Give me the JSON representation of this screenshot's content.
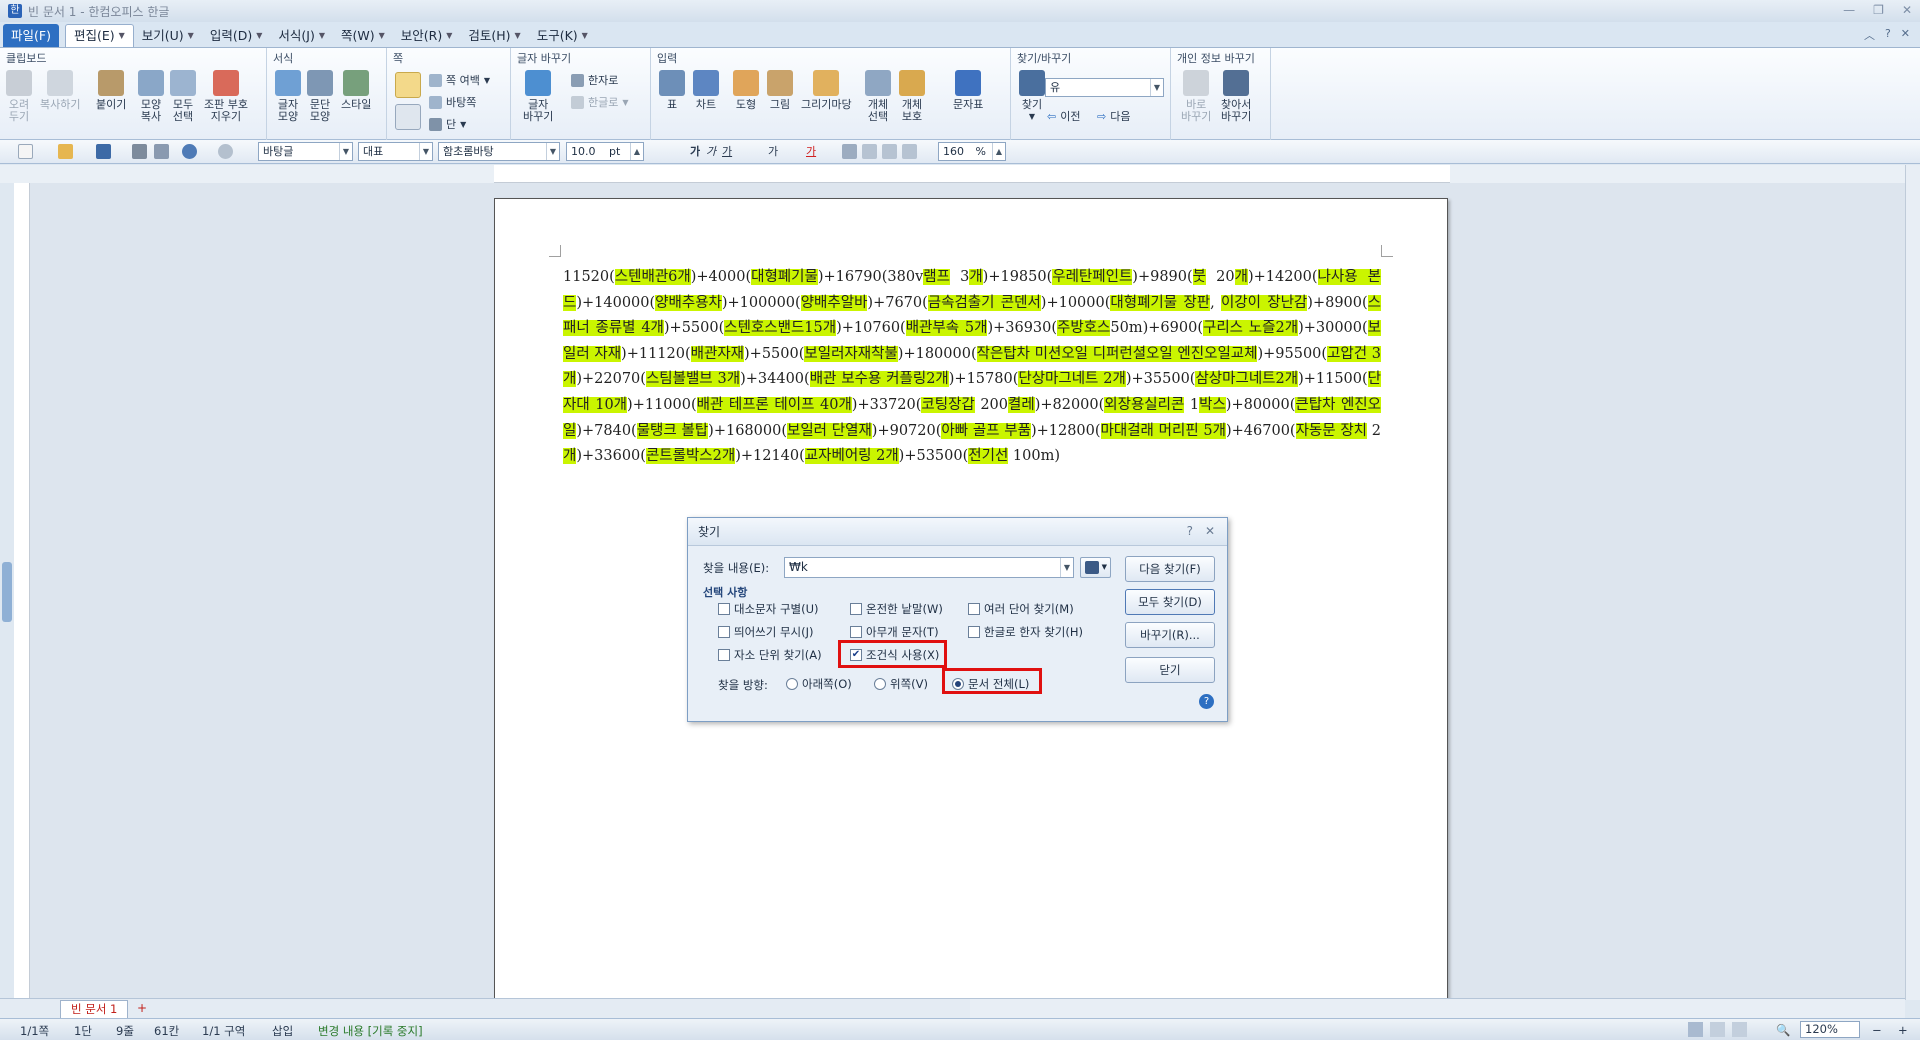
{
  "window": {
    "title": "빈 문서 1 - 한컴오피스 한글",
    "min": "—",
    "restore": "❐",
    "close": "✕"
  },
  "menu": {
    "items": [
      "파일(F)",
      "편집(E)",
      "보기(U)",
      "입력(D)",
      "서식(J)",
      "쪽(W)",
      "보안(R)",
      "검토(H)",
      "도구(K)"
    ],
    "right": [
      "︿",
      "?",
      "✕"
    ]
  },
  "ribbon": {
    "groups": {
      "clipboard": "클립보드",
      "format": "서식",
      "page": "쪽",
      "charchange": "글자 바꾸기",
      "input": "입력",
      "findreplace": "찾기/바꾸기",
      "privacy": "개인 정보 바꾸기"
    },
    "clipboard": {
      "cut": "오려\n두기",
      "copy": "복사하기",
      "paste": "붙이기",
      "shape_copy": "모양\n복사",
      "select_all": "모두\n선택",
      "remove_code": "조판 부호\n지우기"
    },
    "format": {
      "char_shape": "글자\n모양",
      "para_shape": "문단\n모양",
      "style": "스타일"
    },
    "page": {
      "margin": "쪽 여백",
      "background": "바탕쪽",
      "columns": "단"
    },
    "charchange": {
      "convert": "글자\n바꾸기",
      "hanja": "한자로",
      "hangul": "한글로"
    },
    "input": {
      "table": "표",
      "chart": "차트",
      "shape": "도형",
      "picture": "그림",
      "drawing": "그리기마당",
      "obj_select": "개체\n선택",
      "obj_protect": "개체\n보호",
      "symbols": "문자표"
    },
    "findreplace": {
      "find": "찾기",
      "combo_value": "유",
      "prev": "이전",
      "next": "다음"
    },
    "privacy": {
      "replace": "바로\n바꾸기",
      "find_replace": "찾아서\n바꾸기"
    }
  },
  "toolbar": {
    "style": "바탕글",
    "lang": "대표",
    "font": "함초롬바탕",
    "size": "10.0",
    "unit": "pt",
    "bold": "가",
    "italic": "가",
    "underline": "가",
    "strike": "가",
    "color": "가",
    "zoom": "160",
    "zoom_unit": "%"
  },
  "document": {
    "segments": [
      [
        "11520(",
        false
      ],
      [
        "스텐배관6개",
        true
      ],
      [
        ")+4000(",
        false
      ],
      [
        "대형폐기물",
        true
      ],
      [
        ")+16790(380v",
        false
      ],
      [
        "램프",
        true
      ],
      [
        " 3",
        false
      ],
      [
        "개",
        true
      ],
      [
        ")+19850(",
        false
      ],
      [
        "우레탄페인트",
        true
      ],
      [
        ")+9890(",
        false
      ],
      [
        "붓",
        true
      ],
      [
        " 20",
        false
      ],
      [
        "개",
        true
      ],
      [
        ")+14200(",
        false
      ],
      [
        "나사용 본드",
        true
      ],
      [
        ")+140000(",
        false
      ],
      [
        "양배추용차",
        true
      ],
      [
        ")+100000(",
        false
      ],
      [
        "양배추알바",
        true
      ],
      [
        ")+7670(",
        false
      ],
      [
        "금속검출기 콘덴서",
        true
      ],
      [
        ")+10000(",
        false
      ],
      [
        "대형폐기물 장판",
        true
      ],
      [
        ", ",
        false
      ],
      [
        "이강이 장난감",
        true
      ],
      [
        ")+8900(",
        false
      ],
      [
        "스패너 종류별 4개",
        true
      ],
      [
        ")+5500(",
        false
      ],
      [
        "스텐호스밴드15개",
        true
      ],
      [
        ")+10760(",
        false
      ],
      [
        "배관부속 5개",
        true
      ],
      [
        ")+36930(",
        false
      ],
      [
        "주방호스",
        true
      ],
      [
        "50m)+6900(",
        false
      ],
      [
        "구리스 노즐2개",
        true
      ],
      [
        ")+30000(",
        false
      ],
      [
        "보일러 자재",
        true
      ],
      [
        ")+11120(",
        false
      ],
      [
        "배관자재",
        true
      ],
      [
        ")+5500(",
        false
      ],
      [
        "보일러자재착불",
        true
      ],
      [
        ")+180000(",
        false
      ],
      [
        "작은탑차 미션오일 디퍼런셜오일 엔진오일교체",
        true
      ],
      [
        ")+95500(",
        false
      ],
      [
        "고압건 3개",
        true
      ],
      [
        ")+22070(",
        false
      ],
      [
        "스팀볼밸브 3개",
        true
      ],
      [
        ")+34400(",
        false
      ],
      [
        "배관 보수용  커플링2개",
        true
      ],
      [
        ")+15780(",
        false
      ],
      [
        "단상마그네트 2개",
        true
      ],
      [
        ")+35500(",
        false
      ],
      [
        "삼상마그네트2개",
        true
      ],
      [
        ")+11500(",
        false
      ],
      [
        "단자대 10개",
        true
      ],
      [
        ")+11000(",
        false
      ],
      [
        "배관 테프론 테이프 40개",
        true
      ],
      [
        ")+33720(",
        false
      ],
      [
        "코팅장갑",
        true
      ],
      [
        " 200",
        false
      ],
      [
        "켤레",
        true
      ],
      [
        ")+82000(",
        false
      ],
      [
        "외장용실리콘",
        true
      ],
      [
        " 1",
        false
      ],
      [
        "박스",
        true
      ],
      [
        ")+80000(",
        false
      ],
      [
        "큰탑차 엔진오일",
        true
      ],
      [
        ")+7840(",
        false
      ],
      [
        "물탱크 볼탑",
        true
      ],
      [
        ")+168000(",
        false
      ],
      [
        "보일러 단열재",
        true
      ],
      [
        ")+90720(",
        false
      ],
      [
        "아빠 골프 부품",
        true
      ],
      [
        ")+12800(",
        false
      ],
      [
        "마대걸래 머리핀 5개",
        true
      ],
      [
        ")+46700(",
        false
      ],
      [
        "자동문 장치",
        true
      ],
      [
        " 2",
        false
      ],
      [
        "개",
        true
      ],
      [
        ")+33600(",
        false
      ],
      [
        "콘트롤박스2개",
        true
      ],
      [
        ")+12140(",
        false
      ],
      [
        "교자베어링 2개",
        true
      ],
      [
        ")+53500(",
        false
      ],
      [
        "전기선",
        true
      ],
      [
        " 100m)",
        false
      ]
    ]
  },
  "dialog": {
    "title": "찾기",
    "help": "?",
    "close": "✕",
    "find_label": "찾을 내용(E):",
    "find_value": "₩k",
    "options_title": "선택 사항",
    "options": [
      {
        "label": "대소문자 구별(U)",
        "checked": false
      },
      {
        "label": "온전한 낱말(W)",
        "checked": false
      },
      {
        "label": "여러 단어 찾기(M)",
        "checked": false
      },
      {
        "label": "띄어쓰기 무시(J)",
        "checked": false
      },
      {
        "label": "아무개 문자(T)",
        "checked": false
      },
      {
        "label": "한글로 한자 찾기(H)",
        "checked": false
      },
      {
        "label": "자소 단위 찾기(A)",
        "checked": false
      },
      {
        "label": "조건식 사용(X)",
        "checked": true
      }
    ],
    "direction_label": "찾을 방향:",
    "directions": [
      {
        "label": "아래쪽(O)",
        "selected": false
      },
      {
        "label": "위쪽(V)",
        "selected": false
      },
      {
        "label": "문서 전체(L)",
        "selected": true
      }
    ],
    "buttons": {
      "next": "다음 찾기(F)",
      "all": "모두 찾기(D)",
      "replace": "바꾸기(R)...",
      "close": "닫기"
    }
  },
  "tab": {
    "name": "빈 문서 1",
    "new": "+"
  },
  "status": {
    "page": "1/1쪽",
    "column": "1단",
    "line": "9줄",
    "col": "61칸",
    "section": "1/1 구역",
    "insert": "삽입",
    "track": "변경 내용 [기록 중지]",
    "zoom": "120%"
  },
  "colors": {
    "highlight": "#caf500",
    "accent": "#2d6fc2",
    "redbox": "#e01010"
  }
}
